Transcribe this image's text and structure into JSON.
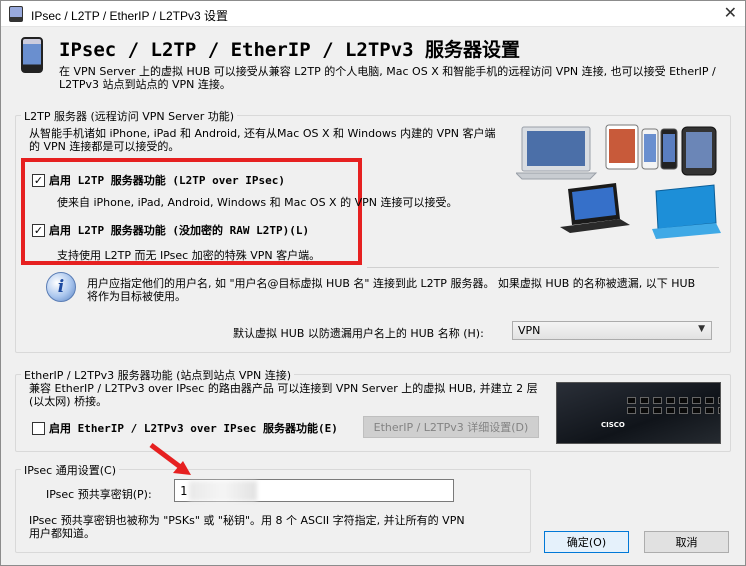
{
  "window": {
    "title": "IPsec / L2TP / EtherIP / L2TPv3 设置",
    "close_glyph": "✕"
  },
  "header": {
    "title": "IPsec / L2TP / EtherIP / L2TPv3 服务器设置",
    "description": "在 VPN Server 上的虚拟 HUB 可以接受从兼容 L2TP 的个人电脑, Mac OS X 和智能手机的远程访问 VPN 连接, 也可以接受 EtherIP / L2TPv3 站点到站点的 VPN 连接。"
  },
  "l2tp_group": {
    "label": "L2TP 服务器 (远程访问 VPN Server 功能)",
    "description": "从智能手机诸如 iPhone, iPad 和 Android, 还有从Mac OS X 和 Windows 内建的 VPN 客户端的 VPN 连接都是可以接受的。",
    "l2tp_ipsec_checkbox": {
      "label": "启用 L2TP 服务器功能 (L2TP over IPsec)",
      "checked": true,
      "description": "使来自 iPhone, iPad, Android, Windows 和 Mac OS X 的 VPN 连接可以接受。"
    },
    "raw_l2tp_checkbox": {
      "label": "启用 L2TP 服务器功能 (没加密的 RAW L2TP)(L)",
      "checked": true,
      "description": "支持使用 L2TP 而无 IPsec 加密的特殊 VPN 客户端。"
    },
    "info_icon_glyph": "i",
    "info_text": "用户应指定他们的用户名, 如 \"用户名@目标虚拟 HUB 名\" 连接到此 L2TP 服务器。 如果虚拟 HUB 的名称被遗漏, 以下 HUB 将作为目标被使用。",
    "default_hub_label": "默认虚拟 HUB 以防遗漏用户名上的 HUB 名称 (H):",
    "default_hub_value": "VPN",
    "dropdown_glyph": "▼"
  },
  "etherip_group": {
    "label": "EtherIP / L2TPv3 服务器功能 (站点到站点 VPN 连接)",
    "description": "兼容 EtherIP / L2TPv3 over IPsec 的路由器产品 可以连接到 VPN Server 上的虚拟 HUB, 并建立 2 层 (以太网) 桥接。",
    "checkbox": {
      "label": "启用 EtherIP / L2TPv3 over IPsec 服务器功能(E)",
      "checked": false
    },
    "detail_button": "EtherIP / L2TPv3 详细设置(D)",
    "router_logo": "CISCO"
  },
  "ipsec_group": {
    "label": "IPsec 通用设置(C)",
    "psk_label": "IPsec 预共享密钥(P):",
    "psk_value": "1",
    "psk_description": "IPsec 预共享密钥也被称为 \"PSKs\" 或 \"秘钥\"。用 8 个 ASCII 字符指定, 并让所有的 VPN 用户都知道。"
  },
  "footer": {
    "ok_button": "确定(O)",
    "cancel_button": "取消"
  },
  "colors": {
    "highlight_border": "#e62020",
    "annotation_arrow": "#e62020",
    "window_bg": "#f0f0f0"
  }
}
